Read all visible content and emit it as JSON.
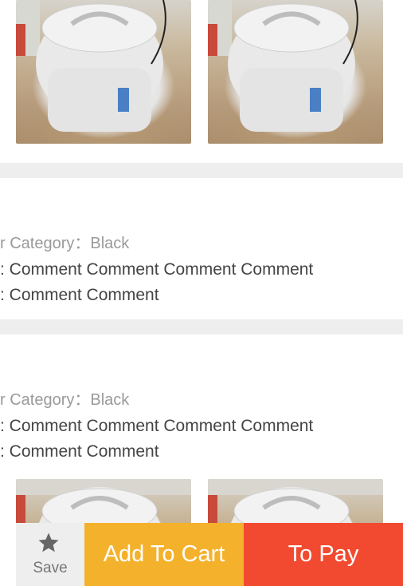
{
  "reviews": [
    {
      "spec": "r Category：Black",
      "comment_lines": [
        ": Comment Comment Comment Comment",
        ": Comment Comment"
      ]
    },
    {
      "spec": "r Category：Black",
      "comment_lines": [
        ": Comment Comment Comment Comment",
        ": Comment Comment"
      ]
    }
  ],
  "images": {
    "icon": "rice-cooker-photo"
  },
  "bottom_bar": {
    "save_label": "Save",
    "save_icon": "star-icon",
    "add_to_cart_label": "Add To Cart",
    "to_pay_label": "To Pay"
  },
  "colors": {
    "add_to_cart": "#f4b12c",
    "to_pay": "#f24a30",
    "separator": "#eeeeee"
  }
}
